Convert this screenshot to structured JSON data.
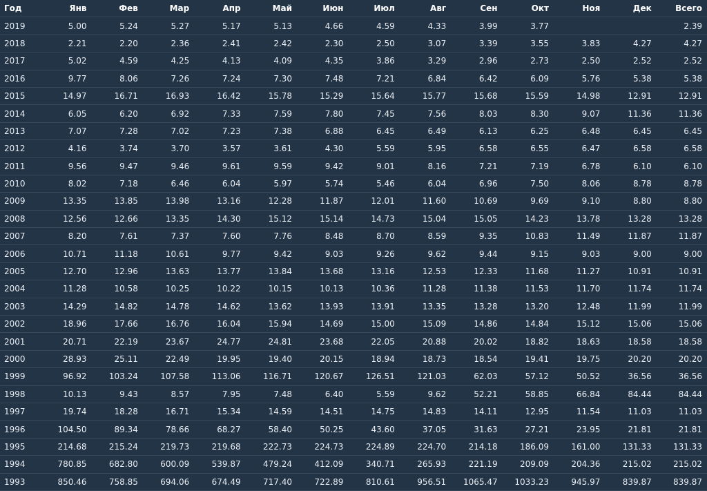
{
  "table": {
    "headers": [
      "Год",
      "Янв",
      "Фев",
      "Мар",
      "Апр",
      "Май",
      "Июн",
      "Июл",
      "Авг",
      "Сен",
      "Окт",
      "Ноя",
      "Дек",
      "Всего"
    ],
    "rows": [
      [
        "2019",
        "5.00",
        "5.24",
        "5.27",
        "5.17",
        "5.13",
        "4.66",
        "4.59",
        "4.33",
        "3.99",
        "3.77",
        "",
        "",
        "2.39"
      ],
      [
        "2018",
        "2.21",
        "2.20",
        "2.36",
        "2.41",
        "2.42",
        "2.30",
        "2.50",
        "3.07",
        "3.39",
        "3.55",
        "3.83",
        "4.27",
        "4.27"
      ],
      [
        "2017",
        "5.02",
        "4.59",
        "4.25",
        "4.13",
        "4.09",
        "4.35",
        "3.86",
        "3.29",
        "2.96",
        "2.73",
        "2.50",
        "2.52",
        "2.52"
      ],
      [
        "2016",
        "9.77",
        "8.06",
        "7.26",
        "7.24",
        "7.30",
        "7.48",
        "7.21",
        "6.84",
        "6.42",
        "6.09",
        "5.76",
        "5.38",
        "5.38"
      ],
      [
        "2015",
        "14.97",
        "16.71",
        "16.93",
        "16.42",
        "15.78",
        "15.29",
        "15.64",
        "15.77",
        "15.68",
        "15.59",
        "14.98",
        "12.91",
        "12.91"
      ],
      [
        "2014",
        "6.05",
        "6.20",
        "6.92",
        "7.33",
        "7.59",
        "7.80",
        "7.45",
        "7.56",
        "8.03",
        "8.30",
        "9.07",
        "11.36",
        "11.36"
      ],
      [
        "2013",
        "7.07",
        "7.28",
        "7.02",
        "7.23",
        "7.38",
        "6.88",
        "6.45",
        "6.49",
        "6.13",
        "6.25",
        "6.48",
        "6.45",
        "6.45"
      ],
      [
        "2012",
        "4.16",
        "3.74",
        "3.70",
        "3.57",
        "3.61",
        "4.30",
        "5.59",
        "5.95",
        "6.58",
        "6.55",
        "6.47",
        "6.58",
        "6.58"
      ],
      [
        "2011",
        "9.56",
        "9.47",
        "9.46",
        "9.61",
        "9.59",
        "9.42",
        "9.01",
        "8.16",
        "7.21",
        "7.19",
        "6.78",
        "6.10",
        "6.10"
      ],
      [
        "2010",
        "8.02",
        "7.18",
        "6.46",
        "6.04",
        "5.97",
        "5.74",
        "5.46",
        "6.04",
        "6.96",
        "7.50",
        "8.06",
        "8.78",
        "8.78"
      ],
      [
        "2009",
        "13.35",
        "13.85",
        "13.98",
        "13.16",
        "12.28",
        "11.87",
        "12.01",
        "11.60",
        "10.69",
        "9.69",
        "9.10",
        "8.80",
        "8.80"
      ],
      [
        "2008",
        "12.56",
        "12.66",
        "13.35",
        "14.30",
        "15.12",
        "15.14",
        "14.73",
        "15.04",
        "15.05",
        "14.23",
        "13.78",
        "13.28",
        "13.28"
      ],
      [
        "2007",
        "8.20",
        "7.61",
        "7.37",
        "7.60",
        "7.76",
        "8.48",
        "8.70",
        "8.59",
        "9.35",
        "10.83",
        "11.49",
        "11.87",
        "11.87"
      ],
      [
        "2006",
        "10.71",
        "11.18",
        "10.61",
        "9.77",
        "9.42",
        "9.03",
        "9.26",
        "9.62",
        "9.44",
        "9.15",
        "9.03",
        "9.00",
        "9.00"
      ],
      [
        "2005",
        "12.70",
        "12.96",
        "13.63",
        "13.77",
        "13.84",
        "13.68",
        "13.16",
        "12.53",
        "12.33",
        "11.68",
        "11.27",
        "10.91",
        "10.91"
      ],
      [
        "2004",
        "11.28",
        "10.58",
        "10.25",
        "10.22",
        "10.15",
        "10.13",
        "10.36",
        "11.28",
        "11.38",
        "11.53",
        "11.70",
        "11.74",
        "11.74"
      ],
      [
        "2003",
        "14.29",
        "14.82",
        "14.78",
        "14.62",
        "13.62",
        "13.93",
        "13.91",
        "13.35",
        "13.28",
        "13.20",
        "12.48",
        "11.99",
        "11.99"
      ],
      [
        "2002",
        "18.96",
        "17.66",
        "16.76",
        "16.04",
        "15.94",
        "14.69",
        "15.00",
        "15.09",
        "14.86",
        "14.84",
        "15.12",
        "15.06",
        "15.06"
      ],
      [
        "2001",
        "20.71",
        "22.19",
        "23.67",
        "24.77",
        "24.81",
        "23.68",
        "22.05",
        "20.88",
        "20.02",
        "18.82",
        "18.63",
        "18.58",
        "18.58"
      ],
      [
        "2000",
        "28.93",
        "25.11",
        "22.49",
        "19.95",
        "19.40",
        "20.15",
        "18.94",
        "18.73",
        "18.54",
        "19.41",
        "19.75",
        "20.20",
        "20.20"
      ],
      [
        "1999",
        "96.92",
        "103.24",
        "107.58",
        "113.06",
        "116.71",
        "120.67",
        "126.51",
        "121.03",
        "62.03",
        "57.12",
        "50.52",
        "36.56",
        "36.56"
      ],
      [
        "1998",
        "10.13",
        "9.43",
        "8.57",
        "7.95",
        "7.48",
        "6.40",
        "5.59",
        "9.62",
        "52.21",
        "58.85",
        "66.84",
        "84.44",
        "84.44"
      ],
      [
        "1997",
        "19.74",
        "18.28",
        "16.71",
        "15.34",
        "14.59",
        "14.51",
        "14.75",
        "14.83",
        "14.11",
        "12.95",
        "11.54",
        "11.03",
        "11.03"
      ],
      [
        "1996",
        "104.50",
        "89.34",
        "78.66",
        "68.27",
        "58.40",
        "50.25",
        "43.60",
        "37.05",
        "31.63",
        "27.21",
        "23.95",
        "21.81",
        "21.81"
      ],
      [
        "1995",
        "214.68",
        "215.24",
        "219.73",
        "219.68",
        "222.73",
        "224.73",
        "224.89",
        "224.70",
        "214.18",
        "186.09",
        "161.00",
        "131.33",
        "131.33"
      ],
      [
        "1994",
        "780.85",
        "682.80",
        "600.09",
        "539.87",
        "479.24",
        "412.09",
        "340.71",
        "265.93",
        "221.19",
        "209.09",
        "204.36",
        "215.02",
        "215.02"
      ],
      [
        "1993",
        "850.46",
        "758.85",
        "694.06",
        "674.49",
        "717.40",
        "722.89",
        "810.61",
        "956.51",
        "1065.47",
        "1033.23",
        "945.97",
        "839.87",
        "839.87"
      ]
    ]
  }
}
